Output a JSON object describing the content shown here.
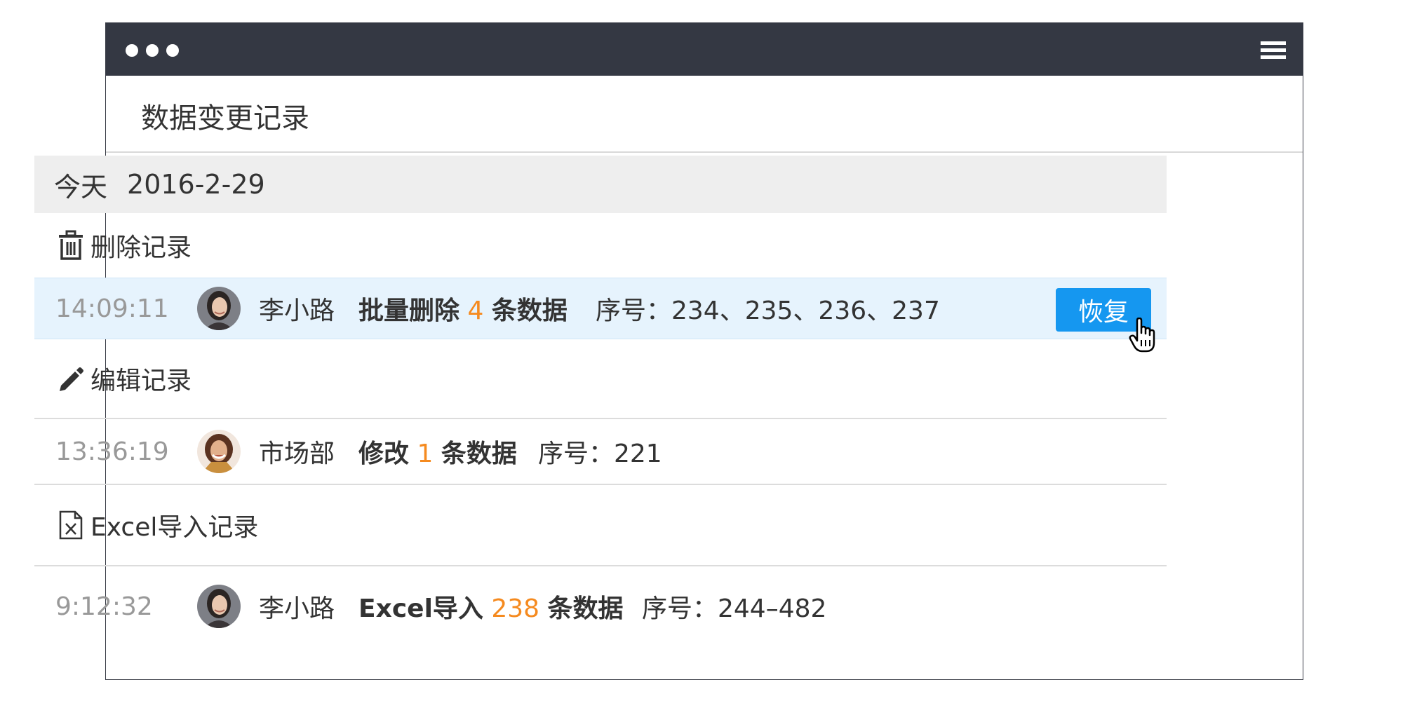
{
  "window": {
    "title_bar_icons": [
      "dots-icon",
      "menu-icon"
    ]
  },
  "header": {
    "title": "数据变更记录"
  },
  "date_group": {
    "day_label": "今天",
    "date": "2016-2-29"
  },
  "sections": {
    "delete": {
      "icon": "trash-icon",
      "label": "删除记录",
      "row": {
        "time": "14:09:11",
        "user": "李小路",
        "action_prefix": "批量删除",
        "count": "4",
        "action_suffix": "条数据",
        "serial": "序号：234、235、236、237",
        "restore_label": "恢复"
      }
    },
    "edit": {
      "icon": "pencil-icon",
      "label": "编辑记录",
      "row": {
        "time": "13:36:19",
        "user": "市场部",
        "action_prefix": "修改",
        "count": "1",
        "action_suffix": "条数据",
        "serial": "序号：221"
      }
    },
    "excel": {
      "icon": "excel-file-icon",
      "label": "Excel导入记录",
      "row": {
        "time": "9:12:32",
        "user": "李小路",
        "action_prefix": "Excel导入",
        "count": "238",
        "action_suffix": "条数据",
        "serial": "序号：244–482"
      }
    }
  },
  "colors": {
    "titlebar": "#343843",
    "accent_button": "#1597f0",
    "count_highlight": "#f58a1f",
    "row_highlight": "#e6f3fd"
  }
}
